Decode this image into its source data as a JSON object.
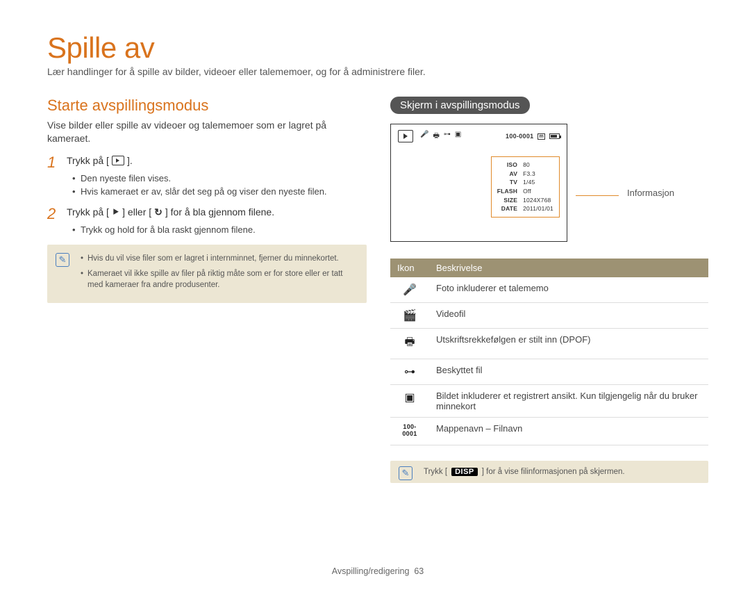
{
  "header": {
    "title": "Spille av",
    "subtitle": "Lær handlinger for å spille av bilder, videoer eller talememoer, og for å administrere filer."
  },
  "left": {
    "h2": "Starte avspillingsmodus",
    "intro": "Vise bilder eller spille av videoer og talememoer som er lagret på kameraet.",
    "step1": {
      "num": "1",
      "text_a": "Trykk på [",
      "text_b": "].",
      "bullets": [
        "Den nyeste filen vises.",
        "Hvis kameraet er av, slår det seg på og viser den nyeste filen."
      ]
    },
    "step2": {
      "num": "2",
      "text_a": "Trykk på [",
      "text_mid": "] eller [",
      "text_b": "] for å bla gjennom filene.",
      "bullets": [
        "Trykk og hold for å bla raskt gjennom filene."
      ]
    },
    "note": {
      "items": [
        "Hvis du vil vise filer som er lagret i internminnet, fjerner du minnekortet.",
        "Kameraet vil ikke spille av filer på riktig måte som er for store eller er tatt med kameraer fra andre produsenter."
      ]
    }
  },
  "right": {
    "pill": "Skjerm i avspillingsmodus",
    "folder_file": "100-0001",
    "info_label": "Informasjon",
    "info_rows": [
      [
        "ISO",
        "80"
      ],
      [
        "AV",
        "F3.3"
      ],
      [
        "TV",
        "1/45"
      ],
      [
        "FLASH",
        "Off"
      ],
      [
        "SIZE",
        "1024X768"
      ],
      [
        "DATE",
        "2011/01/01"
      ]
    ],
    "table": {
      "head_icon": "Ikon",
      "head_desc": "Beskrivelse",
      "rows": [
        {
          "icon": "mic-icon",
          "glyph": "🎤",
          "desc": "Foto inkluderer et talememo"
        },
        {
          "icon": "video-icon",
          "glyph": "🎬",
          "desc": "Videofil"
        },
        {
          "icon": "printer-icon",
          "glyph": "🖶",
          "desc": "Utskriftsrekkefølgen er stilt inn (DPOF)"
        },
        {
          "icon": "lock-icon",
          "glyph": "⊶",
          "desc": "Beskyttet fil"
        },
        {
          "icon": "face-icon",
          "glyph": "▣",
          "desc": "Bildet inkluderer et registrert ansikt. Kun tilgjengelig når du bruker minnekort"
        },
        {
          "icon": "folder-file-label",
          "glyph": "100-0001",
          "desc": "Mappenavn – Filnavn"
        }
      ]
    },
    "note2_a": "Trykk [",
    "note2_disp": "DISP",
    "note2_b": "] for å vise filinformasjonen på skjermen."
  },
  "footer": {
    "section": "Avspilling/redigering",
    "page": "63"
  }
}
